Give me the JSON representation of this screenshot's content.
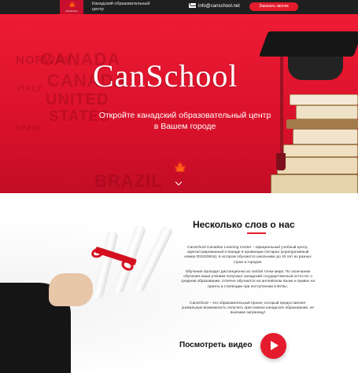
{
  "header": {
    "logo_text": "CanSchool",
    "tagline": "Канадский образовательный центр",
    "email": "info@canschool.net",
    "call_button": "Заказать звонок"
  },
  "hero": {
    "title": "CanSchool",
    "subtitle_line1": "Откройте канадский образовательный центр",
    "subtitle_line2": "в Вашем городе",
    "watermarks": [
      "CANADA",
      "CANADA",
      "UNITED",
      "STATES",
      "BRAZIL",
      "NORWAY",
      "ITALY",
      "SPAIN"
    ]
  },
  "about": {
    "title": "Несколько слов о нас",
    "para1": "CanSchool Canadian Learning Centre – официальный учебный центр, зарегистрированный в Канаде в провинции Онтарио (корпоративный номер 002420616), в котором обучаются школьники до 16 лет из разных стран и городов.",
    "para2": "Обучение проходит дистанционно из любой точки мира. По окончанию обучения наши ученики получают канадский государственный аттестат о среднем образовании, отлично обучаются на английском языке и правах на гранты и стипендии при поступлении в ВУЗы.",
    "para3": "CanSchool – это образовательный проект, который предоставляет уникальную возможность получить престижное канадское образование, не выезжая заграницу!",
    "video_label": "Посмотреть видео"
  },
  "colors": {
    "brand_red": "#e41b2c",
    "topbar": "#1f1f1f"
  }
}
